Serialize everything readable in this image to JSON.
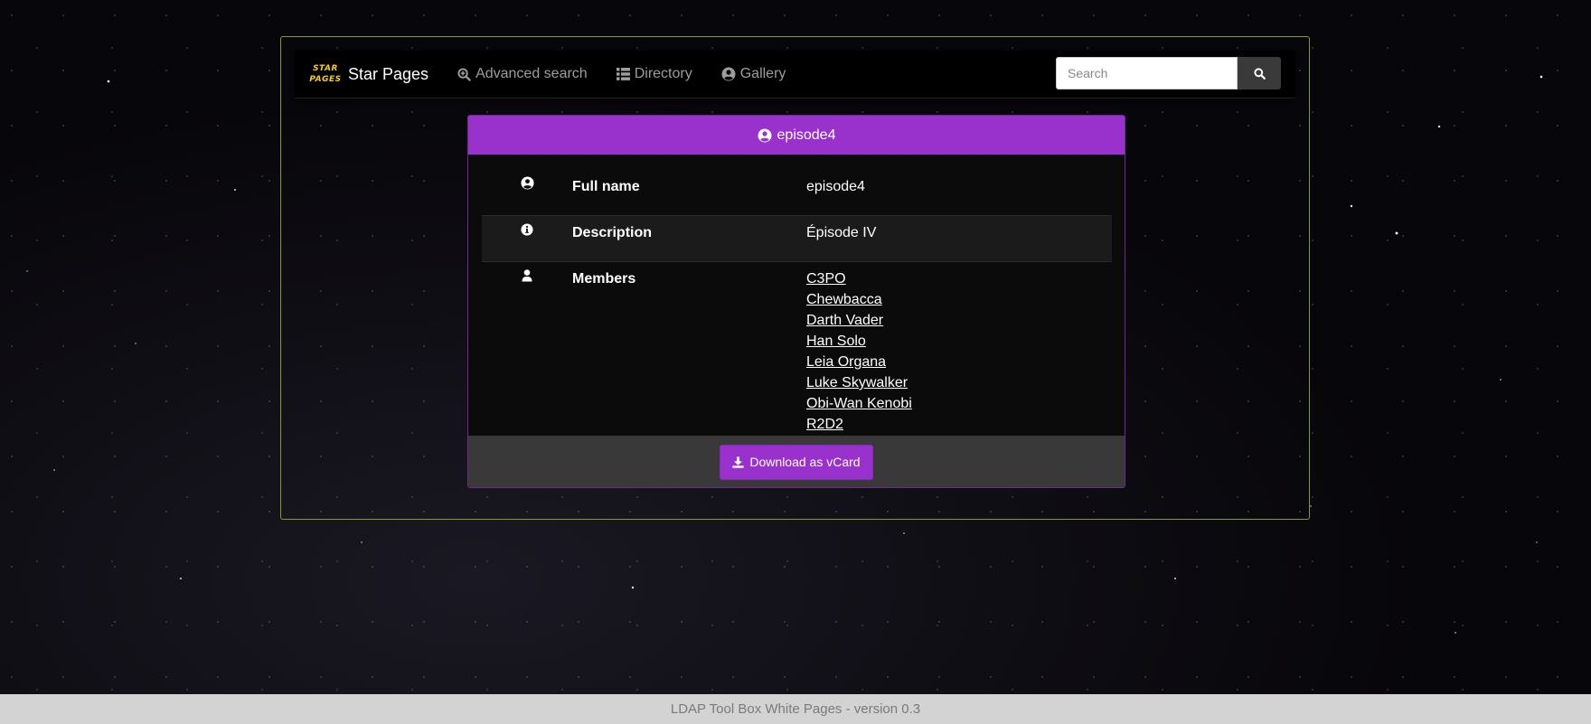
{
  "brand": {
    "logo_line1": "STAR",
    "logo_line2": "PAGES",
    "name": "Star Pages"
  },
  "nav": {
    "advanced_search": "Advanced search",
    "directory": "Directory",
    "gallery": "Gallery"
  },
  "search": {
    "placeholder": "Search",
    "value": ""
  },
  "entry": {
    "title": "episode4",
    "rows": [
      {
        "icon": "user-circle-icon",
        "label": "Full name",
        "value": "episode4"
      },
      {
        "icon": "info-circle-icon",
        "label": "Description",
        "value": "Épisode IV"
      },
      {
        "icon": "user-icon",
        "label": "Members",
        "values": [
          "C3PO",
          "Chewbacca",
          "Darth Vader",
          "Han Solo",
          "Leia Organa",
          "Luke Skywalker",
          "Obi-Wan Kenobi",
          "R2D2"
        ]
      }
    ],
    "download_label": "Download as vCard"
  },
  "footer": {
    "text": "LDAP Tool Box White Pages - version 0.3"
  },
  "colors": {
    "accent": "#9932cc",
    "logo_yellow": "#f5d20a",
    "container_border": "#8a9a1e"
  }
}
